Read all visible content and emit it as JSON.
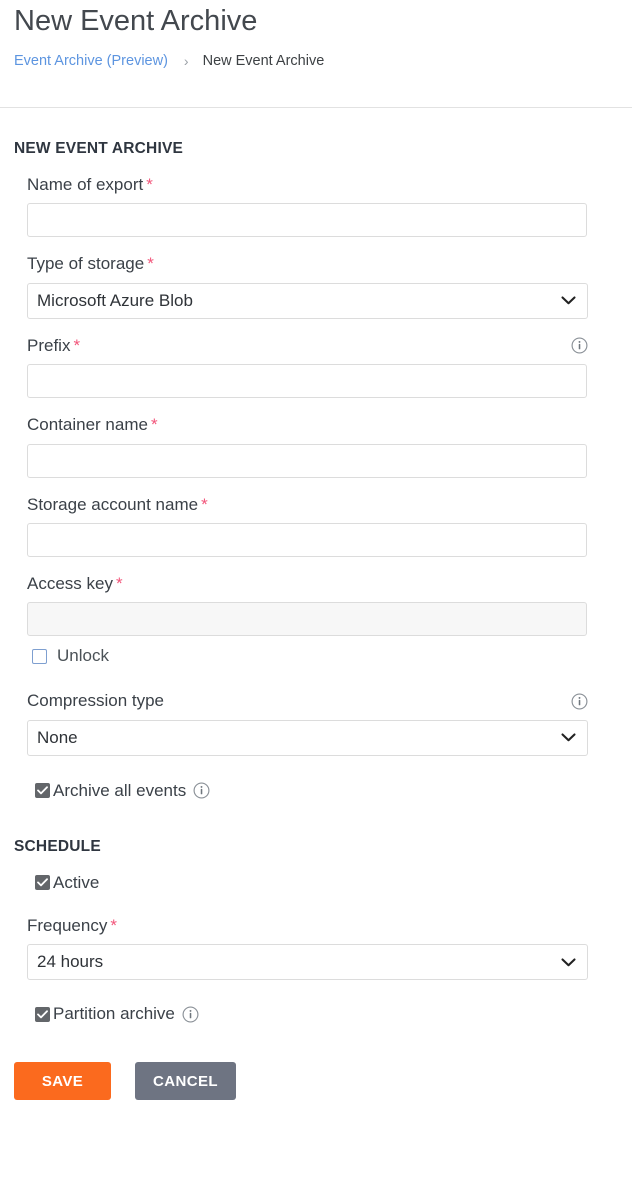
{
  "header": {
    "title": "New Event Archive",
    "breadcrumb": {
      "parent": "Event Archive (Preview)",
      "separator": "›",
      "current": "New Event Archive"
    }
  },
  "sections": {
    "archive": {
      "heading": "NEW EVENT ARCHIVE",
      "name_of_export": {
        "label": "Name of export",
        "required_marker": "*",
        "value": "",
        "placeholder": ""
      },
      "type_of_storage": {
        "label": "Type of storage",
        "required_marker": "*",
        "selected": "Microsoft Azure Blob"
      },
      "prefix": {
        "label": "Prefix",
        "required_marker": "*",
        "value": "",
        "placeholder": "",
        "info_icon": "info-icon"
      },
      "container_name": {
        "label": "Container name",
        "required_marker": "*",
        "value": "",
        "placeholder": ""
      },
      "storage_account_name": {
        "label": "Storage account name",
        "required_marker": "*",
        "value": "",
        "placeholder": ""
      },
      "access_key": {
        "label": "Access key",
        "required_marker": "*",
        "value": "",
        "placeholder": "",
        "disabled": true
      },
      "unlock": {
        "label": "Unlock",
        "checked": false
      },
      "compression_type": {
        "label": "Compression type",
        "selected": "None",
        "info_icon": "info-icon"
      },
      "archive_all_events": {
        "label": "Archive all events",
        "checked": true,
        "info_icon": "info-icon"
      }
    },
    "schedule": {
      "heading": "SCHEDULE",
      "active": {
        "label": "Active",
        "checked": true
      },
      "frequency": {
        "label": "Frequency",
        "required_marker": "*",
        "selected": "24 hours"
      },
      "partition_archive": {
        "label": "Partition archive",
        "checked": true,
        "info_icon": "info-icon"
      }
    }
  },
  "actions": {
    "save_label": "SAVE",
    "cancel_label": "CANCEL"
  },
  "colors": {
    "save_button": "#fb6a1e",
    "cancel_button": "#6e7482",
    "required_asterisk": "#f2557a",
    "breadcrumb_link": "#5d95e0",
    "checkbox_checked": "#63666a",
    "checkbox_unchecked_border": "#7e9fd0"
  }
}
